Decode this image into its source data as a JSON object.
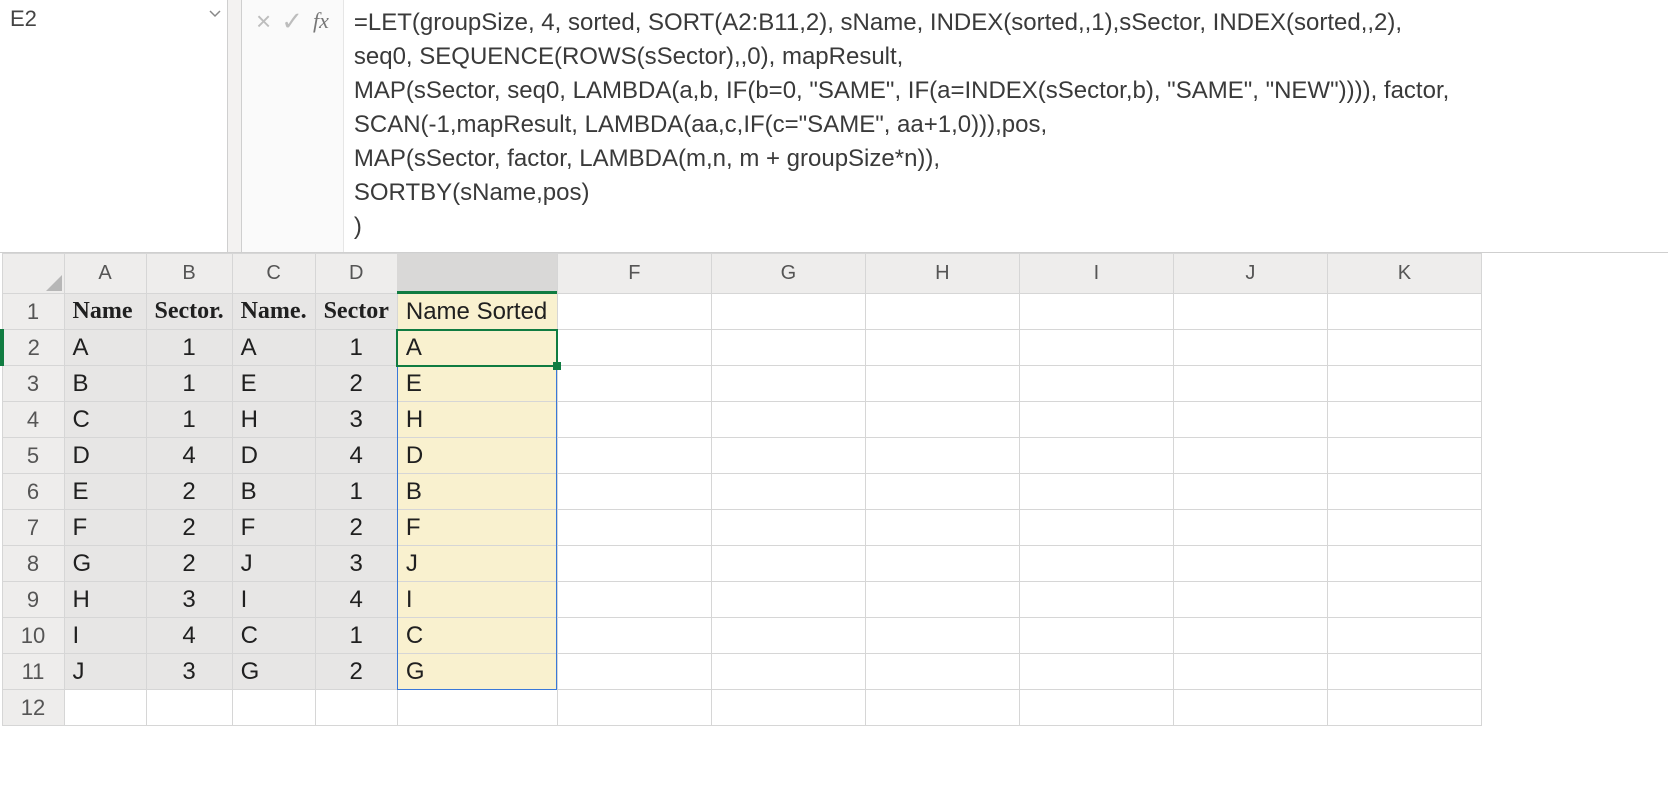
{
  "nameBox": {
    "value": "E2"
  },
  "fbarButtons": {
    "cancel": "×",
    "confirm": "✓",
    "fx": "fx"
  },
  "formula": "=LET(groupSize, 4, sorted, SORT(A2:B11,2), sName, INDEX(sorted,,1),sSector, INDEX(sorted,,2),\nseq0, SEQUENCE(ROWS(sSector),,0), mapResult,\nMAP(sSector, seq0, LAMBDA(a,b, IF(b=0, \"SAME\", IF(a=INDEX(sSector,b), \"SAME\", \"NEW\")))), factor,\nSCAN(-1,mapResult, LAMBDA(aa,c,IF(c=\"SAME\", aa+1,0))),pos,\nMAP(sSector, factor, LAMBDA(m,n, m + groupSize*n)),\nSORTBY(sName,pos)\n)",
  "columnHeaders": [
    "A",
    "B",
    "C",
    "D",
    "E",
    "F",
    "G",
    "H",
    "I",
    "J",
    "K"
  ],
  "rowHeaders": [
    "1",
    "2",
    "3",
    "4",
    "5",
    "6",
    "7",
    "8",
    "9",
    "10",
    "11",
    "12"
  ],
  "headerRow": {
    "A": "Name",
    "B": "Sector.",
    "C": "Name.",
    "D": "Sector",
    "E": "Name Sorted"
  },
  "rows": [
    {
      "A": "A",
      "B": "1",
      "C": "A",
      "D": "1",
      "E": "A"
    },
    {
      "A": "B",
      "B": "1",
      "C": "E",
      "D": "2",
      "E": "E"
    },
    {
      "A": "C",
      "B": "1",
      "C": "H",
      "D": "3",
      "E": "H"
    },
    {
      "A": "D",
      "B": "4",
      "C": "D",
      "D": "4",
      "E": "D"
    },
    {
      "A": "E",
      "B": "2",
      "C": "B",
      "D": "1",
      "E": "B"
    },
    {
      "A": "F",
      "B": "2",
      "C": "F",
      "D": "2",
      "E": "F"
    },
    {
      "A": "G",
      "B": "2",
      "C": "J",
      "D": "3",
      "E": "J"
    },
    {
      "A": "H",
      "B": "3",
      "C": "I",
      "D": "4",
      "E": "I"
    },
    {
      "A": "I",
      "B": "4",
      "C": "C",
      "D": "1",
      "E": "C"
    },
    {
      "A": "J",
      "B": "3",
      "C": "G",
      "D": "2",
      "E": "G"
    }
  ],
  "chart_data": {
    "type": "table",
    "title": "",
    "columns": [
      "Name",
      "Sector.",
      "Name.",
      "Sector",
      "Name Sorted"
    ],
    "records": [
      [
        "A",
        1,
        "A",
        1,
        "A"
      ],
      [
        "B",
        1,
        "E",
        2,
        "E"
      ],
      [
        "C",
        1,
        "H",
        3,
        "H"
      ],
      [
        "D",
        4,
        "D",
        4,
        "D"
      ],
      [
        "E",
        2,
        "B",
        1,
        "B"
      ],
      [
        "F",
        2,
        "F",
        2,
        "F"
      ],
      [
        "G",
        2,
        "J",
        3,
        "J"
      ],
      [
        "H",
        3,
        "I",
        4,
        "I"
      ],
      [
        "I",
        4,
        "C",
        1,
        "C"
      ],
      [
        "J",
        3,
        "G",
        2,
        "G"
      ]
    ]
  }
}
